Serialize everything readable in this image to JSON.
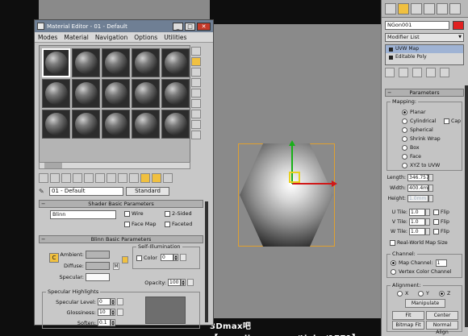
{
  "material_editor": {
    "title": "Material Editor - 01 - Default",
    "menu": [
      "Modes",
      "Material",
      "Navigation",
      "Options",
      "Utilities"
    ],
    "slot_count": 15,
    "active_slot": 0,
    "material_name": "01 - Default",
    "material_type": "Standard",
    "shader_rollout": "Shader Basic Parameters",
    "shader_type": "Blinn",
    "shader_flags": [
      "Wire",
      "2-Sided",
      "Face Map",
      "Faceted"
    ],
    "blinn_rollout": "Blinn Basic Parameters",
    "ambient_label": "Ambient:",
    "diffuse_label": "Diffuse:",
    "specular_label": "Specular:",
    "map_letter_m": "M",
    "lock_letter": "C",
    "self_illum": {
      "title": "Self-Illumination",
      "color_label": "Color",
      "color_value": "0"
    },
    "opacity": {
      "label": "Opacity:",
      "value": "100"
    },
    "spec_highlights": {
      "title": "Specular Highlights",
      "level_label": "Specular Level:",
      "level_value": "0",
      "gloss_label": "Glossiness:",
      "gloss_value": "10",
      "soften_label": "Soften:",
      "soften_value": "0.1"
    }
  },
  "command_panel": {
    "object_name": "NGon001",
    "modifier_list": "Modifier List",
    "stack": [
      "UVW Map",
      "Editable Poly"
    ],
    "params_rollout": "Parameters",
    "mapping": {
      "title": "Mapping:",
      "options": [
        "Planar",
        "Cylindrical",
        "Spherical",
        "Shrink Wrap",
        "Box",
        "Face",
        "XYZ to UVW"
      ],
      "selected": "Planar",
      "cap_label": "Cap"
    },
    "length": {
      "label": "Length:",
      "value": "346.757"
    },
    "width": {
      "label": "Width:",
      "value": "400.4mm"
    },
    "height": {
      "label": "Height:",
      "value": "1.0mm"
    },
    "u_tile": {
      "label": "U Tile:",
      "value": "1.0"
    },
    "v_tile": {
      "label": "V Tile:",
      "value": "1.0"
    },
    "w_tile": {
      "label": "W Tile:",
      "value": "1.0"
    },
    "flip_label": "Flip",
    "real_world": "Real-World Map Size",
    "channel": {
      "title": "Channel:",
      "map_channel_label": "Map Channel:",
      "map_channel_value": "1",
      "vertex_color": "Vertex Color Channel"
    },
    "alignment": {
      "title": "Alignment:",
      "axes": [
        "X",
        "Y",
        "Z"
      ],
      "selected": "Z",
      "manipulate": "Manipulate",
      "fit": "Fit",
      "center": "Center",
      "bitmap_fit": "Bitmap Fit",
      "normal_align": "Normal Align"
    }
  },
  "watermark": "3Dmax吧 【www.linecg.com/tieba/1771】",
  "colors": {
    "title_bar": "#6f7f94",
    "selection": "#f0c040",
    "object_color": "#e02020"
  }
}
